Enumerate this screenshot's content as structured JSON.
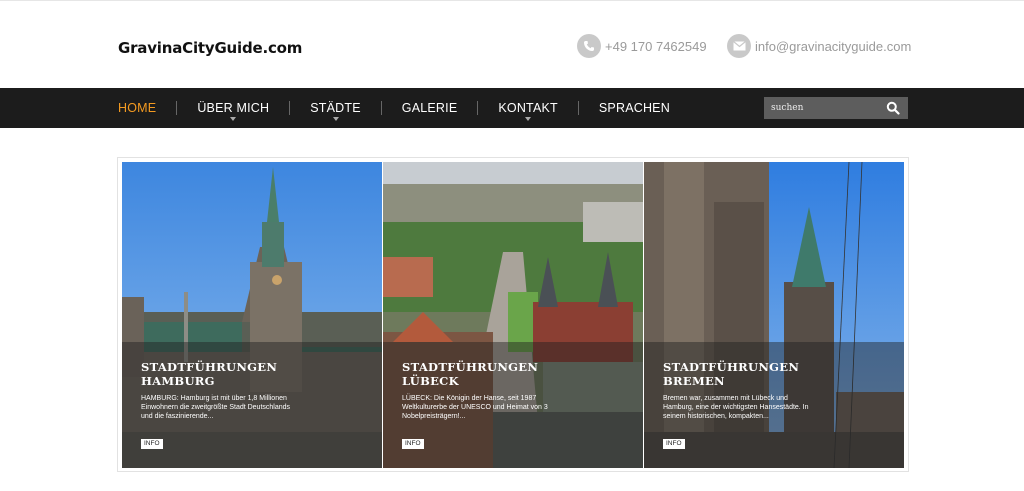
{
  "header": {
    "logo": "GravinaCityGuide.com",
    "phone": "+49 170 7462549",
    "email": "info@gravinacityguide.com"
  },
  "nav": {
    "items": [
      {
        "label": "HOME",
        "active": true,
        "dropdown": false
      },
      {
        "label": "ÜBER MICH",
        "active": false,
        "dropdown": true
      },
      {
        "label": "STÄDTE",
        "active": false,
        "dropdown": true
      },
      {
        "label": "GALERIE",
        "active": false,
        "dropdown": false
      },
      {
        "label": "KONTAKT",
        "active": false,
        "dropdown": true
      },
      {
        "label": "SPRACHEN",
        "active": false,
        "dropdown": false
      }
    ]
  },
  "search": {
    "placeholder": "suchen"
  },
  "colors": {
    "accent": "#f39a21",
    "navbar": "#1c1c1c"
  },
  "slider": {
    "panels": [
      {
        "title_line1": "STADTFÜHRUNGEN",
        "title_line2": "HAMBURG",
        "text": "HAMBURG: Hamburg ist mit über 1,8 Millionen Einwohnern die zweitgrößte Stadt Deutschlands und die faszinierende...",
        "button": "INFO"
      },
      {
        "title_line1": "STADTFÜHRUNGEN",
        "title_line2": "LÜBECK",
        "text": "LÜBECK: Die Königin der Hanse, seit 1987 Weltkulturerbe der UNESCO und Heimat von 3 Nobelpreisträgern!...",
        "button": "INFO"
      },
      {
        "title_line1": "STADTFÜHRUNGEN",
        "title_line2": "BREMEN",
        "text": "Bremen war, zusammen mit Lübeck und Hamburg, eine der wichtigsten Hansestädte. In seinem historischen, kompakten...",
        "button": "INFO"
      }
    ]
  }
}
